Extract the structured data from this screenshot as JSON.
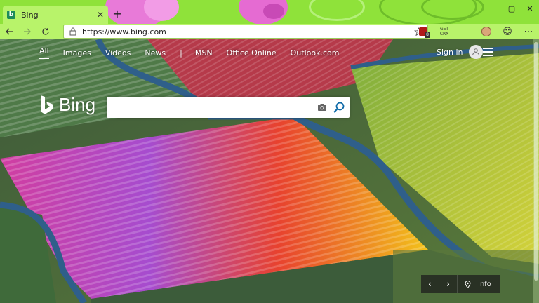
{
  "browser": {
    "tab": {
      "title": "Bing",
      "favicon_letter": "b",
      "close_glyph": "✕"
    },
    "new_tab_glyph": "+",
    "window_controls": [
      "▢",
      "✕"
    ],
    "address": {
      "url": "https://www.bing.com"
    },
    "extensions": {
      "red_badge_count": "8",
      "get_label_1": "GET",
      "get_label_2": "CRX"
    },
    "menu_glyph": "⋯",
    "emoji_glyph": "☺"
  },
  "page": {
    "nav": {
      "items": [
        "All",
        "Images",
        "Videos",
        "News",
        "MSN",
        "Office Online",
        "Outlook.com"
      ],
      "separator": "|"
    },
    "signin": {
      "label": "Sign in"
    },
    "logo": {
      "word": "Bing"
    },
    "search": {
      "value": "",
      "placeholder": ""
    },
    "carousel": {
      "prev": "‹",
      "next": "›",
      "info": "Info"
    }
  },
  "colors": {
    "chrome_green": "#8fe23a",
    "address_green": "#b8f36a",
    "accent_blue": "#0e6aa8"
  }
}
